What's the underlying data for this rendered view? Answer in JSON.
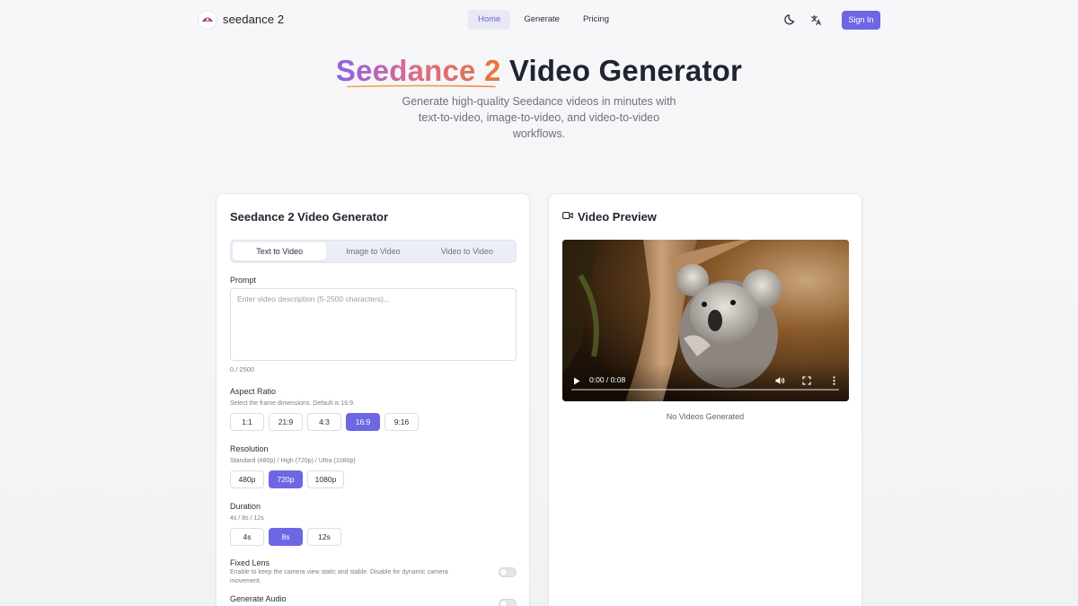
{
  "nav": {
    "brand": "seedance 2",
    "links": [
      "Home",
      "Generate",
      "Pricing"
    ],
    "active_link": "Home",
    "signin_label": "Sign In",
    "accent": "#6d67e4"
  },
  "hero": {
    "title_highlight": "Seedance 2",
    "title_rest": "Video Generator",
    "subtitle": "Generate high-quality Seedance videos in minutes with text-to-video, image-to-video, and video-to-video workflows."
  },
  "generator": {
    "title": "Seedance 2 Video Generator",
    "tabs": [
      "Text to Video",
      "Image to Video",
      "Video to Video"
    ],
    "active_tab": "Text to Video",
    "prompt": {
      "label": "Prompt",
      "placeholder": "Enter video description (5-2500 characters)...",
      "value": "",
      "counter": "0 / 2500"
    },
    "aspect_ratio": {
      "label": "Aspect Ratio",
      "hint": "Select the frame dimensions. Default is 16:9.",
      "options": [
        "1:1",
        "21:9",
        "4:3",
        "16:9",
        "9:16"
      ],
      "selected": "16:9"
    },
    "resolution": {
      "label": "Resolution",
      "hint": "Standard (480p) / High (720p) / Ultra (1080p)",
      "options": [
        "480p",
        "720p",
        "1080p"
      ],
      "selected": "720p"
    },
    "duration": {
      "label": "Duration",
      "hint": "4s / 8s / 12s",
      "options": [
        "4s",
        "8s",
        "12s"
      ],
      "selected": "8s"
    },
    "fixed_lens": {
      "label": "Fixed Lens",
      "hint": "Enable to keep the camera view static and stable. Disable for dynamic camera movement.",
      "enabled": false
    },
    "generate_audio": {
      "label": "Generate Audio",
      "enabled": false
    }
  },
  "preview": {
    "title": "Video Preview",
    "icon": "video-camera-icon",
    "player": {
      "time": "0:00 / 0:08",
      "progress": 0
    },
    "empty_text": "No Videos Generated"
  }
}
